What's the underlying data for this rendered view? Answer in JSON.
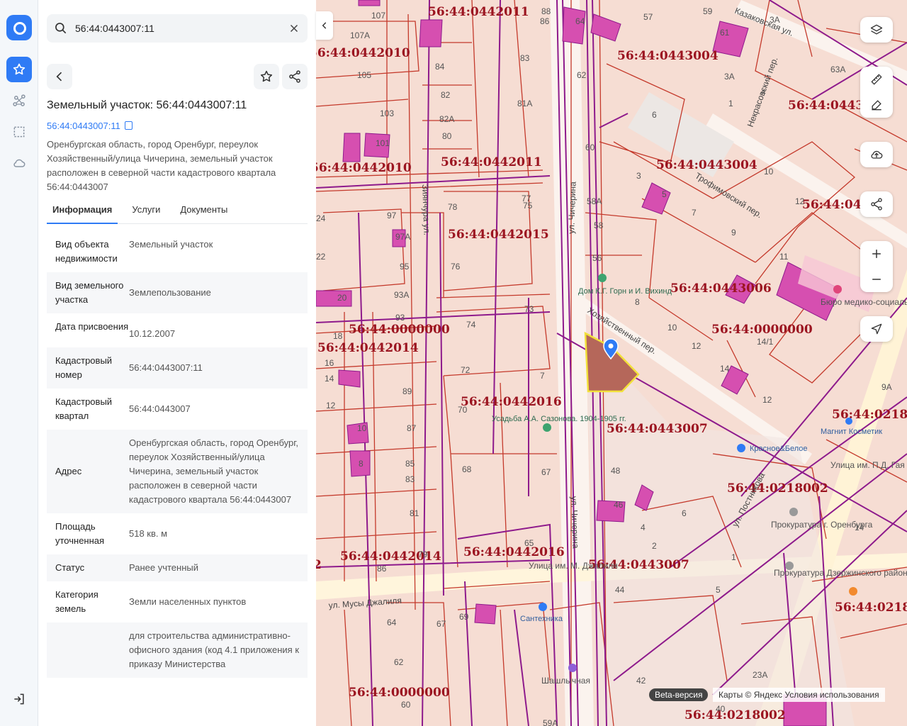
{
  "search": {
    "value": "56:44:0443007:11"
  },
  "object": {
    "title": "Земельный участок: 56:44:0443007:11",
    "cadastral_link": "56:44:0443007:11",
    "address_short": "Оренбургская область, город Оренбург, переулок Хозяйственный/улица Чичерина, земельный участок расположен в северной части кадастрового квартала 56:44:0443007"
  },
  "tabs": [
    "Информация",
    "Услуги",
    "Документы"
  ],
  "rows": [
    {
      "k": "Вид объекта недвижимости",
      "v": "Земельный участок"
    },
    {
      "k": "Вид земельного участка",
      "v": "Землепользование"
    },
    {
      "k": "Дата присвоения",
      "v": "10.12.2007"
    },
    {
      "k": "Кадастровый номер",
      "v": "56:44:0443007:11"
    },
    {
      "k": "Кадастровый квартал",
      "v": "56:44:0443007"
    },
    {
      "k": "Адрес",
      "v": "Оренбургская область, город Оренбург, переулок Хозяйственный/улица Чичерина, земельный участок расположен в северной части кадастрового квартала 56:44:0443007"
    },
    {
      "k": "Площадь уточненная",
      "v": "518 кв. м"
    },
    {
      "k": "Статус",
      "v": "Ранее учтенный"
    },
    {
      "k": "Категория земель",
      "v": "Земли населенных пунктов"
    },
    {
      "k": "",
      "v": "для строительства административно-офисного здания (код 4.1 приложения к приказу Министерства"
    }
  ],
  "map": {
    "cadastral_labels": [
      "56:44:0442011",
      "56:44:0442010",
      "56:44:0443004",
      "56:44:0443",
      "56:44:0442011",
      "56:44:0443004",
      "56:44:0442015",
      "56:44:0443006",
      "56:44:0000000",
      "56:44:0442014",
      "56:44:0000000",
      "56:44:0442016",
      "56:44:0443007",
      "56:44:0218002",
      "56:44:0442014",
      "56:44:0442016",
      "56:44:0443007",
      "56:44:0218",
      "56:44:0000000",
      "56:44:0218002",
      "56:44:0218",
      "56:44:04",
      "56:44:0442010",
      "2"
    ],
    "streets": [
      "ул. Чичерина",
      "Хозяйственный пер.",
      "Трофимовский пер.",
      "Казаковская ул.",
      "ул. Мусы Джалиля",
      "ул. Постникова",
      "Некрасовский пер.",
      "Зиянчура ул."
    ],
    "pois": [
      "Дом К.Г. Горн и И. Вихинд",
      "Усадьба А.А. Сазонова. 1904-1905 гг.",
      "Магнит Косметик",
      "Красное&Белое",
      "Прокуратура г. Оренбурга",
      "Прокуратура Дзержинского района",
      "Улица им. П.Д. Гая",
      "Улица им. М. Джалиля",
      "Сантехника",
      "Шашлычная",
      "Бюро медико-социальной экспертизы"
    ],
    "house_numbers": [
      "107",
      "107А",
      "105",
      "103",
      "101",
      "97",
      "97А",
      "95",
      "93А",
      "93",
      "89",
      "87",
      "85",
      "83",
      "81",
      "79",
      "86",
      "84",
      "82",
      "82А",
      "80",
      "78",
      "76",
      "74",
      "72",
      "70",
      "68",
      "64",
      "62",
      "60",
      "69",
      "67",
      "65",
      "73",
      "75",
      "77",
      "81А",
      "83",
      "86",
      "88",
      "57",
      "59",
      "61",
      "63А",
      "3А",
      "4",
      "6",
      "1",
      "3",
      "5",
      "7",
      "9",
      "11",
      "58А",
      "58",
      "56",
      "60",
      "62",
      "64",
      "8",
      "10",
      "12",
      "14/1",
      "14",
      "12",
      "9А",
      "48",
      "46",
      "44",
      "42",
      "40",
      "6",
      "4",
      "2",
      "5",
      "1",
      "23А",
      "14",
      "8",
      "10",
      "12",
      "16",
      "18",
      "20",
      "22",
      "24",
      "59А"
    ],
    "beta_label": "Beta-версия",
    "attribution": "Карты © Яндекс   Условия использования"
  }
}
